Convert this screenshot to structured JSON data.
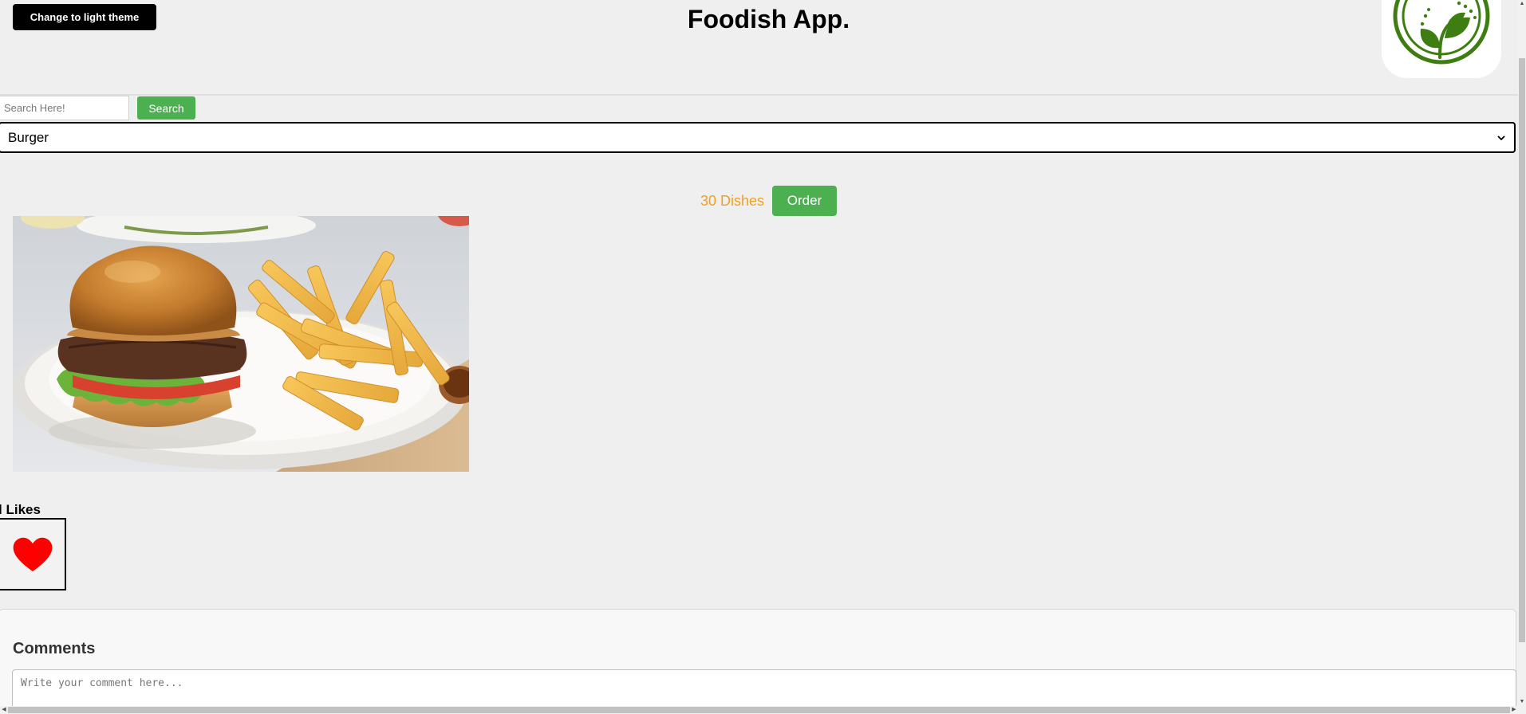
{
  "header": {
    "theme_button_label": "Change to light theme",
    "title": "Foodish App.",
    "logo_icon": "leaf-logo-icon"
  },
  "search": {
    "placeholder": "Search Here!",
    "value": "",
    "button_label": "Search"
  },
  "category": {
    "selected": "Burger",
    "dropdown_icon": "chevron-down-icon"
  },
  "dishes": {
    "count_label": "30 Dishes",
    "order_label": "Order"
  },
  "food": {
    "image_icon": "burger-and-fries-photo"
  },
  "likes": {
    "label": "Likes",
    "icon": "heart-icon"
  },
  "comments": {
    "title": "Comments",
    "placeholder": "Write your comment here...",
    "value": ""
  },
  "colors": {
    "background": "#efefef",
    "accent_green": "#4caf50",
    "dish_count_orange": "#f0a020",
    "logo_green": "#3e7d11",
    "heart_red": "#ff0000"
  }
}
